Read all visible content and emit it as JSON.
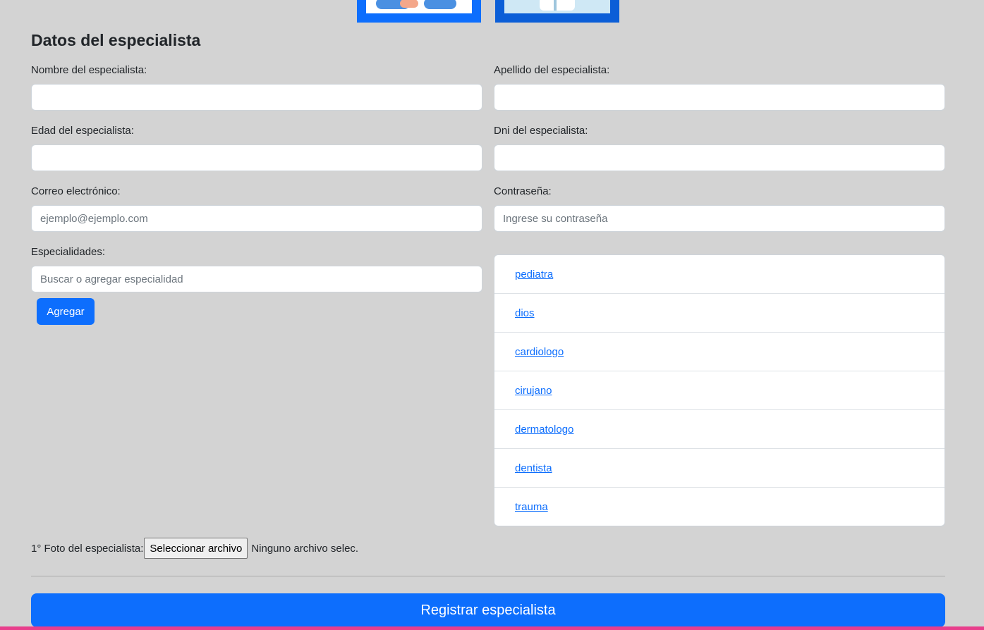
{
  "form": {
    "title": "Datos del especialista",
    "fields": {
      "nombre_label": "Nombre del especialista:",
      "apellido_label": "Apellido del especialista:",
      "edad_label": "Edad del especialista:",
      "dni_label": "Dni del especialista:",
      "correo_label": "Correo electrónico:",
      "correo_placeholder": "ejemplo@ejemplo.com",
      "contrasena_label": "Contraseña:",
      "contrasena_placeholder": "Ingrese su contraseña",
      "especialidades_label": "Especialidades:",
      "especialidades_placeholder": "Buscar o agregar especialidad"
    },
    "add_button": "Agregar",
    "specialties": [
      "pediatra",
      "dios",
      "cardiologo",
      "cirujano",
      "dermatologo",
      "dentista",
      "trauma"
    ],
    "photo": {
      "label": "1° Foto del especialista:",
      "button": "Seleccionar archivo",
      "status": "Ninguno archivo selec."
    },
    "submit": "Registrar especialista"
  },
  "colors": {
    "background": "#d3d3d3",
    "primary": "#0d6efd",
    "bottom_bar": "#e83e8c"
  }
}
